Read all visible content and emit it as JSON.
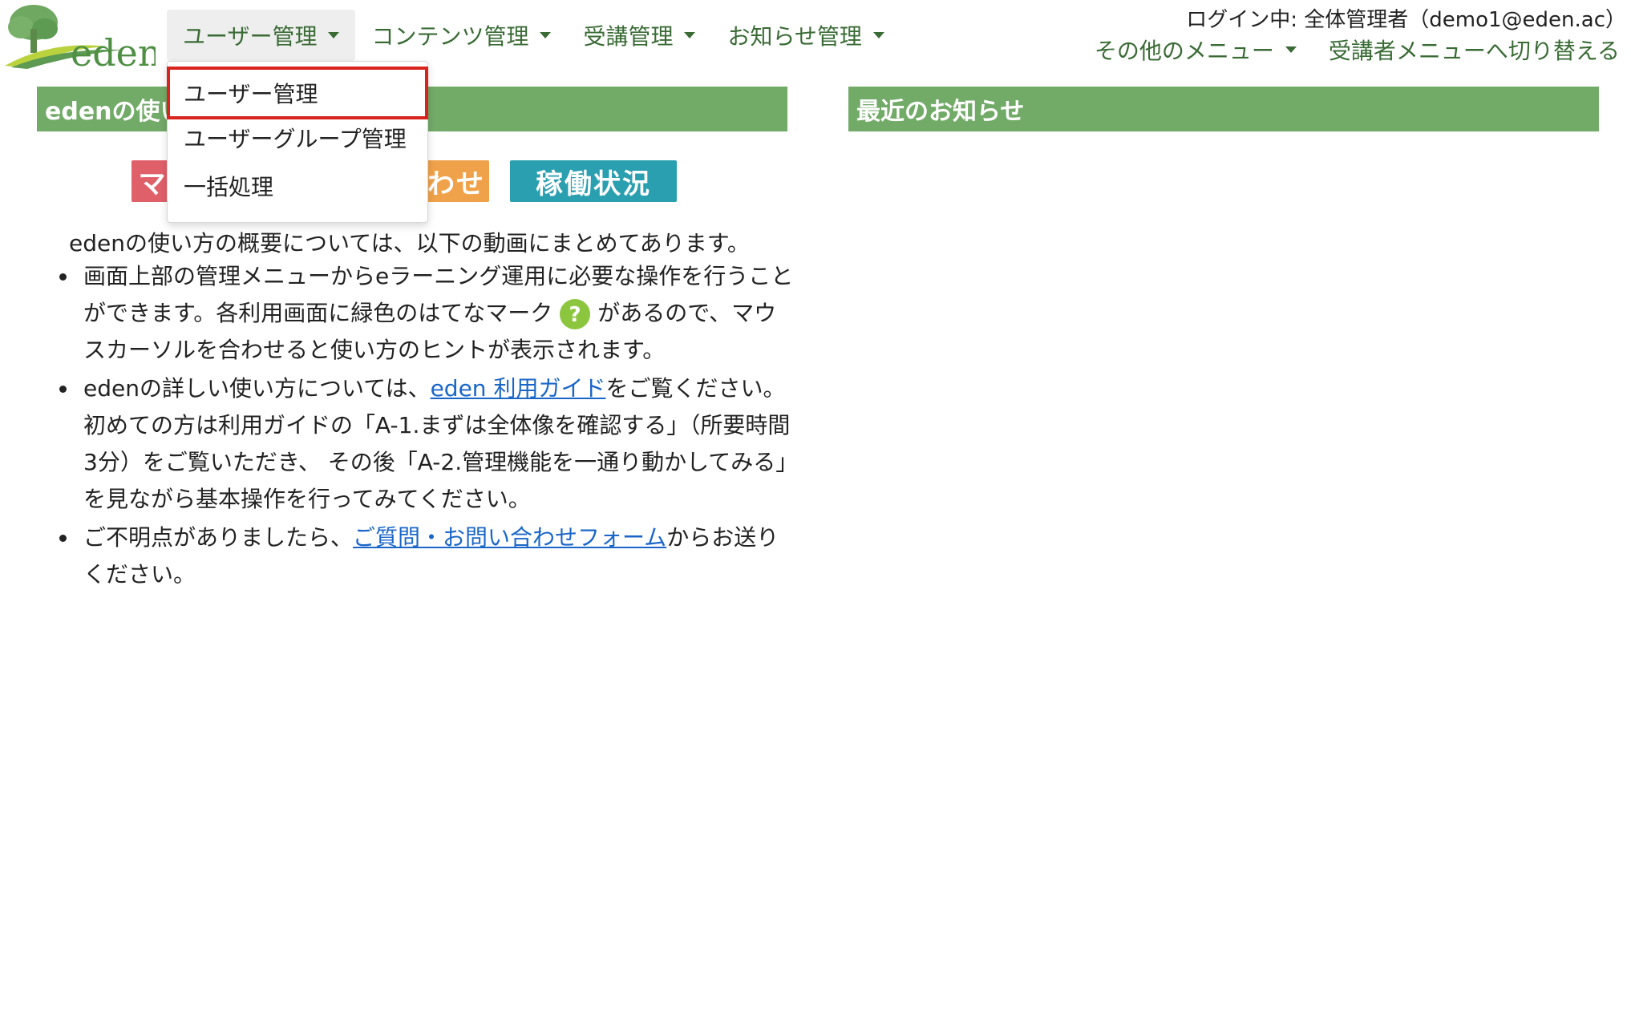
{
  "header": {
    "logo_text": "eden",
    "nav": [
      {
        "label": "ユーザー管理"
      },
      {
        "label": "コンテンツ管理"
      },
      {
        "label": "受講管理"
      },
      {
        "label": "お知らせ管理"
      }
    ],
    "login_info": "ログイン中: 全体管理者（demo1@eden.ac）",
    "other_menu": "その他のメニュー",
    "switch_menu": "受講者メニューへ切り替える"
  },
  "dropdown": {
    "items": [
      {
        "label": "ユーザー管理"
      },
      {
        "label": "ユーザーグループ管理"
      },
      {
        "label": "一括処理"
      }
    ]
  },
  "left_panel": {
    "title": "edenの使い方",
    "banners": [
      {
        "label": "マニュアル",
        "color": "#e0606a"
      },
      {
        "label": "お問い合わせ",
        "color": "#f0a24a"
      },
      {
        "label": "稼働状況",
        "color": "#2a9fb0"
      }
    ],
    "intro": "edenの使い方の概要については、以下の動画にまとめてあります。",
    "bullets": {
      "b1_pre": "画面上部の管理メニューからeラーニング運用に必要な操作を行うことができます。各利用画面に緑色のはてなマーク",
      "b1_post": "があるので、マウスカーソルを合わせると使い方のヒントが表示されます。",
      "b2_pre": "edenの詳しい使い方については、",
      "b2_link": "eden 利用ガイド",
      "b2_post": "をご覧ください。初めての方は利用ガイドの「A-1.まずは全体像を確認する」（所要時間3分）をご覧いただき、 その後「A-2.管理機能を一通り動かしてみる」を見ながら基本操作を行ってみてください。",
      "b3_pre": "ご不明点がありましたら、",
      "b3_link": "ご質問・お問い合わせフォーム",
      "b3_post": "からお送りください。"
    }
  },
  "right_panel": {
    "title": "最近のお知らせ"
  },
  "colors": {
    "header_green": "#72aa68",
    "nav_text": "#3a6b35",
    "link": "#1a66c8",
    "highlight": "#d9231e"
  }
}
